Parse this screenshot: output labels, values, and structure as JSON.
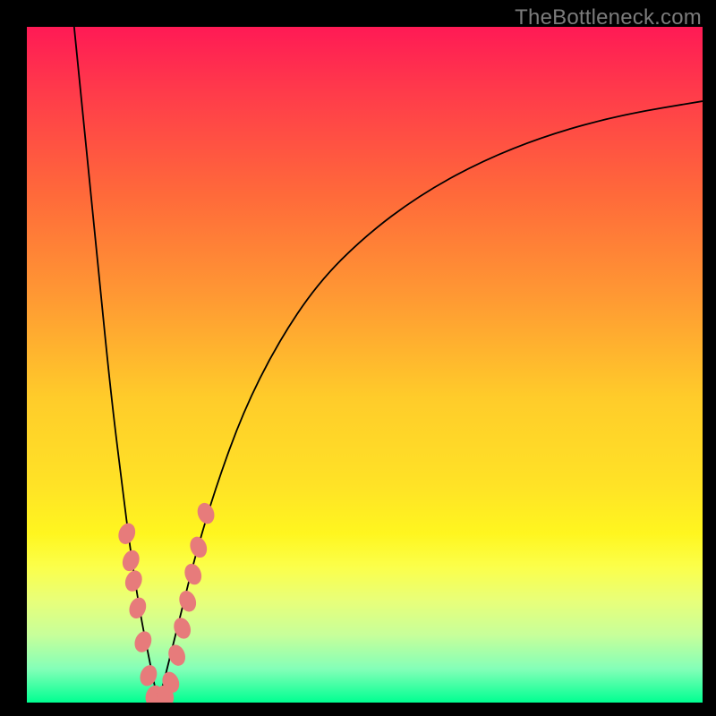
{
  "watermark": "TheBottleneck.com",
  "chart_data": {
    "type": "line",
    "title": "",
    "xlabel": "",
    "ylabel": "",
    "xlim": [
      0,
      100
    ],
    "ylim": [
      0,
      100
    ],
    "background_gradient": {
      "top": "#ff1a55",
      "mid": "#ffe326",
      "bottom": "#00ff91"
    },
    "series": [
      {
        "name": "bottleneck-curve-left",
        "x": [
          7,
          8,
          9,
          10,
          11,
          12,
          13,
          14,
          15,
          16,
          17,
          18,
          19,
          19.5
        ],
        "values": [
          100,
          90,
          80,
          70,
          60,
          50,
          41,
          33,
          25,
          18,
          12,
          7,
          2,
          0
        ]
      },
      {
        "name": "bottleneck-curve-right",
        "x": [
          19.5,
          21,
          23,
          25,
          28,
          32,
          37,
          43,
          50,
          58,
          67,
          77,
          88,
          100
        ],
        "values": [
          0,
          6,
          14,
          22,
          32,
          43,
          53,
          62,
          69,
          75,
          80,
          84,
          87,
          89
        ]
      }
    ],
    "annotations": {
      "name": "data-points-near-minimum",
      "points": [
        {
          "x": 14.8,
          "y": 25
        },
        {
          "x": 15.4,
          "y": 21
        },
        {
          "x": 15.8,
          "y": 18
        },
        {
          "x": 16.4,
          "y": 14
        },
        {
          "x": 17.2,
          "y": 9
        },
        {
          "x": 18.0,
          "y": 4
        },
        {
          "x": 18.8,
          "y": 1
        },
        {
          "x": 19.7,
          "y": 0
        },
        {
          "x": 20.5,
          "y": 1
        },
        {
          "x": 21.3,
          "y": 3
        },
        {
          "x": 22.2,
          "y": 7
        },
        {
          "x": 23.0,
          "y": 11
        },
        {
          "x": 23.8,
          "y": 15
        },
        {
          "x": 24.6,
          "y": 19
        },
        {
          "x": 25.4,
          "y": 23
        },
        {
          "x": 26.5,
          "y": 28
        }
      ]
    },
    "minimum_x": 19.5
  }
}
